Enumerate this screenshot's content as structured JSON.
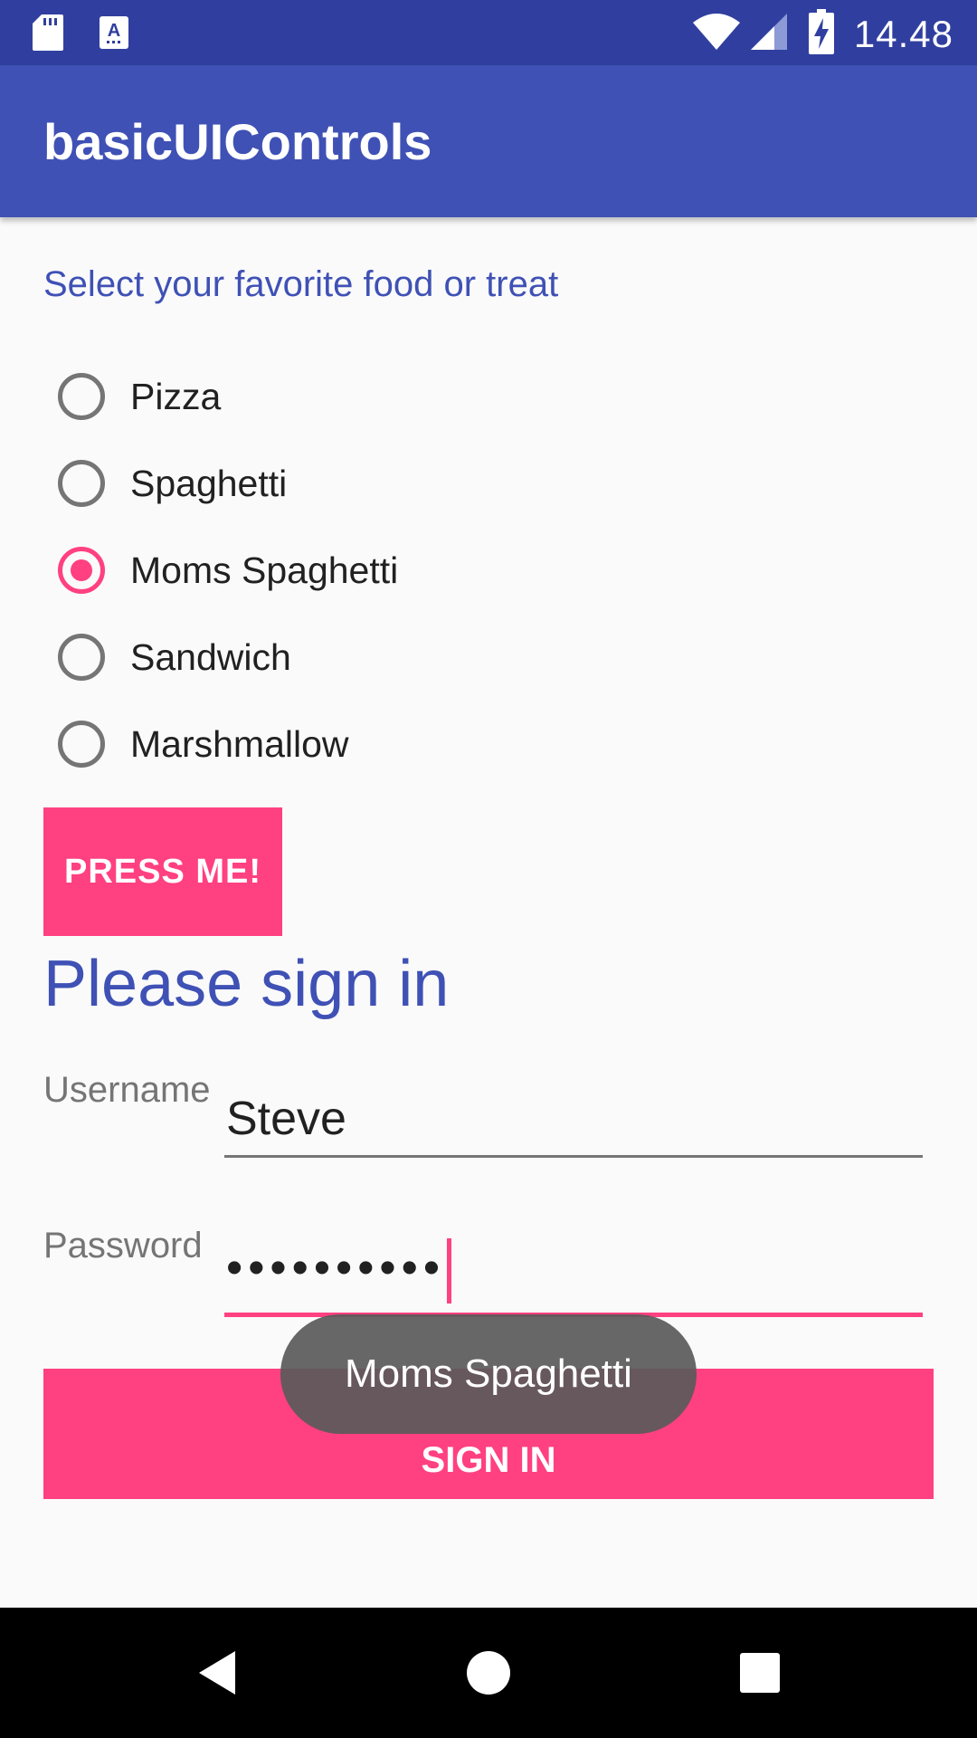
{
  "status_bar": {
    "time": "14.48",
    "icons": [
      "sd-card-icon",
      "keyboard-a-icon",
      "wifi-icon",
      "signal-icon",
      "battery-charging-icon"
    ]
  },
  "app_bar": {
    "title": "basicUIControls"
  },
  "food_section": {
    "prompt": "Select your favorite food or treat",
    "options": [
      {
        "label": "Pizza",
        "checked": false
      },
      {
        "label": "Spaghetti",
        "checked": false
      },
      {
        "label": "Moms Spaghetti",
        "checked": true
      },
      {
        "label": "Sandwich",
        "checked": false
      },
      {
        "label": "Marshmallow",
        "checked": false
      }
    ],
    "press_button": "PRESS ME!"
  },
  "sign_in": {
    "heading": "Please sign in",
    "username_label": "Username",
    "username_value": "Steve",
    "password_label": "Password",
    "password_value": "••••••••••",
    "button": "SIGN IN"
  },
  "toast": {
    "text": "Moms Spaghetti"
  },
  "colors": {
    "primary_dark": "#303f9f",
    "primary": "#3f51b5",
    "accent": "#ff4081"
  },
  "nav_bar": {
    "icons": [
      "back-icon",
      "home-icon",
      "recents-icon"
    ]
  }
}
